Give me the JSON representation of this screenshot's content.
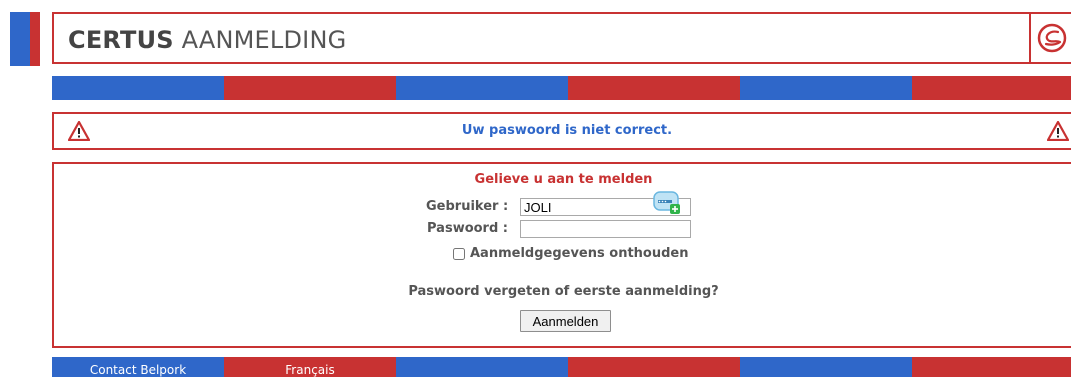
{
  "header": {
    "title_bold": "CERTUS",
    "title_rest": " AANMELDING",
    "logo_icon": "certus-logo-icon"
  },
  "colors": {
    "blue": "#2f67c9",
    "red": "#c83232",
    "alert_text": "#2f67c9",
    "form_title": "#c83232"
  },
  "alert": {
    "message": "Uw paswoord is niet correct.",
    "icon": "warning-triangle-icon"
  },
  "login": {
    "title": "Gelieve u aan te melden",
    "user_label": "Gebruiker :",
    "user_value": "JOLI",
    "password_label": "Paswoord :",
    "password_value": "",
    "remember_label": "Aanmeldgegevens onthouden",
    "remember_checked": false,
    "forgot_text": "Paswoord vergeten of eerste aanmelding?",
    "submit_label": "Aanmelden",
    "password_manager_icon": "password-manager-icon"
  },
  "footer": {
    "contact_label": "Contact Belpork",
    "language_label": "Français"
  }
}
